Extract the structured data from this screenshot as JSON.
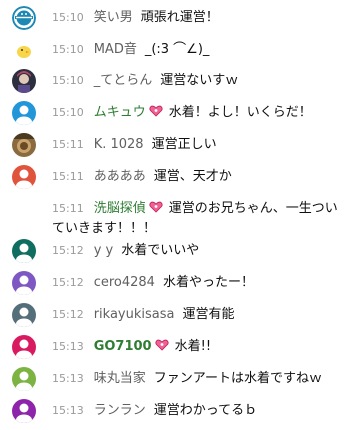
{
  "chat": {
    "messages": [
      {
        "time": "15:10",
        "author": "笑い男",
        "text": "頑張れ運営！",
        "avatar_color": "#1e88b4",
        "avatar_icon": "laughing-man-logo-icon"
      },
      {
        "time": "15:10",
        "author": "MAD音",
        "text": "_(:3 ⌒∠)_",
        "avatar_color": "#f7d64a",
        "avatar_icon": "chick-icon"
      },
      {
        "time": "15:10",
        "author": "_てとらん",
        "text": "運営ないすｗ",
        "avatar_color": "#2c2f3d",
        "avatar_icon": "character-avatar-icon"
      },
      {
        "time": "15:10",
        "author": "ムキュウ",
        "text": "水着！よし！いくらだ！",
        "avatar_color": "#2196d8",
        "avatar_icon": "default-person-icon",
        "member": true,
        "badge_icon": "member-heart-badge-icon"
      },
      {
        "time": "15:11",
        "author": "K. 1028",
        "text": "運営正しい",
        "avatar_color": "#8a6a3f",
        "avatar_icon": "photo-avatar-icon"
      },
      {
        "time": "15:11",
        "author": "ああああ",
        "text": "運営、天才か",
        "avatar_color": "#e0533c",
        "avatar_icon": "default-person-icon"
      },
      {
        "time": "15:11",
        "author": "洗脳探偵",
        "text": "運営のお兄ちゃん、一生ついていきます！！！",
        "avatar_color": "#ffffff",
        "avatar_icon": "blank-avatar-icon",
        "member": true,
        "badge_icon": "member-heart-badge-icon"
      },
      {
        "time": "15:12",
        "author": "y y",
        "text": "水着でいいや",
        "avatar_color": "#0f6e5f",
        "avatar_icon": "default-person-icon"
      },
      {
        "time": "15:12",
        "author": "cero4284",
        "text": "水着やったー！",
        "avatar_color": "#7e57c2",
        "avatar_icon": "default-person-icon"
      },
      {
        "time": "15:12",
        "author": "rikayukisasa",
        "text": "運営有能",
        "avatar_color": "#546e7a",
        "avatar_icon": "default-person-icon"
      },
      {
        "time": "15:13",
        "author": "GO7100",
        "text": "水着!!",
        "avatar_color": "#d81b60",
        "avatar_icon": "default-person-icon",
        "member": true,
        "bold": true,
        "badge_icon": "member-heart-badge-icon"
      },
      {
        "time": "15:13",
        "author": "味丸当家",
        "text": "ファンアートは水着ですねｗ",
        "avatar_color": "#7cb342",
        "avatar_icon": "default-person-icon"
      },
      {
        "time": "15:13",
        "author": "ランラン",
        "text": "運営わかってるｂ",
        "avatar_color": "#8e24aa",
        "avatar_icon": "default-person-icon"
      }
    ]
  }
}
